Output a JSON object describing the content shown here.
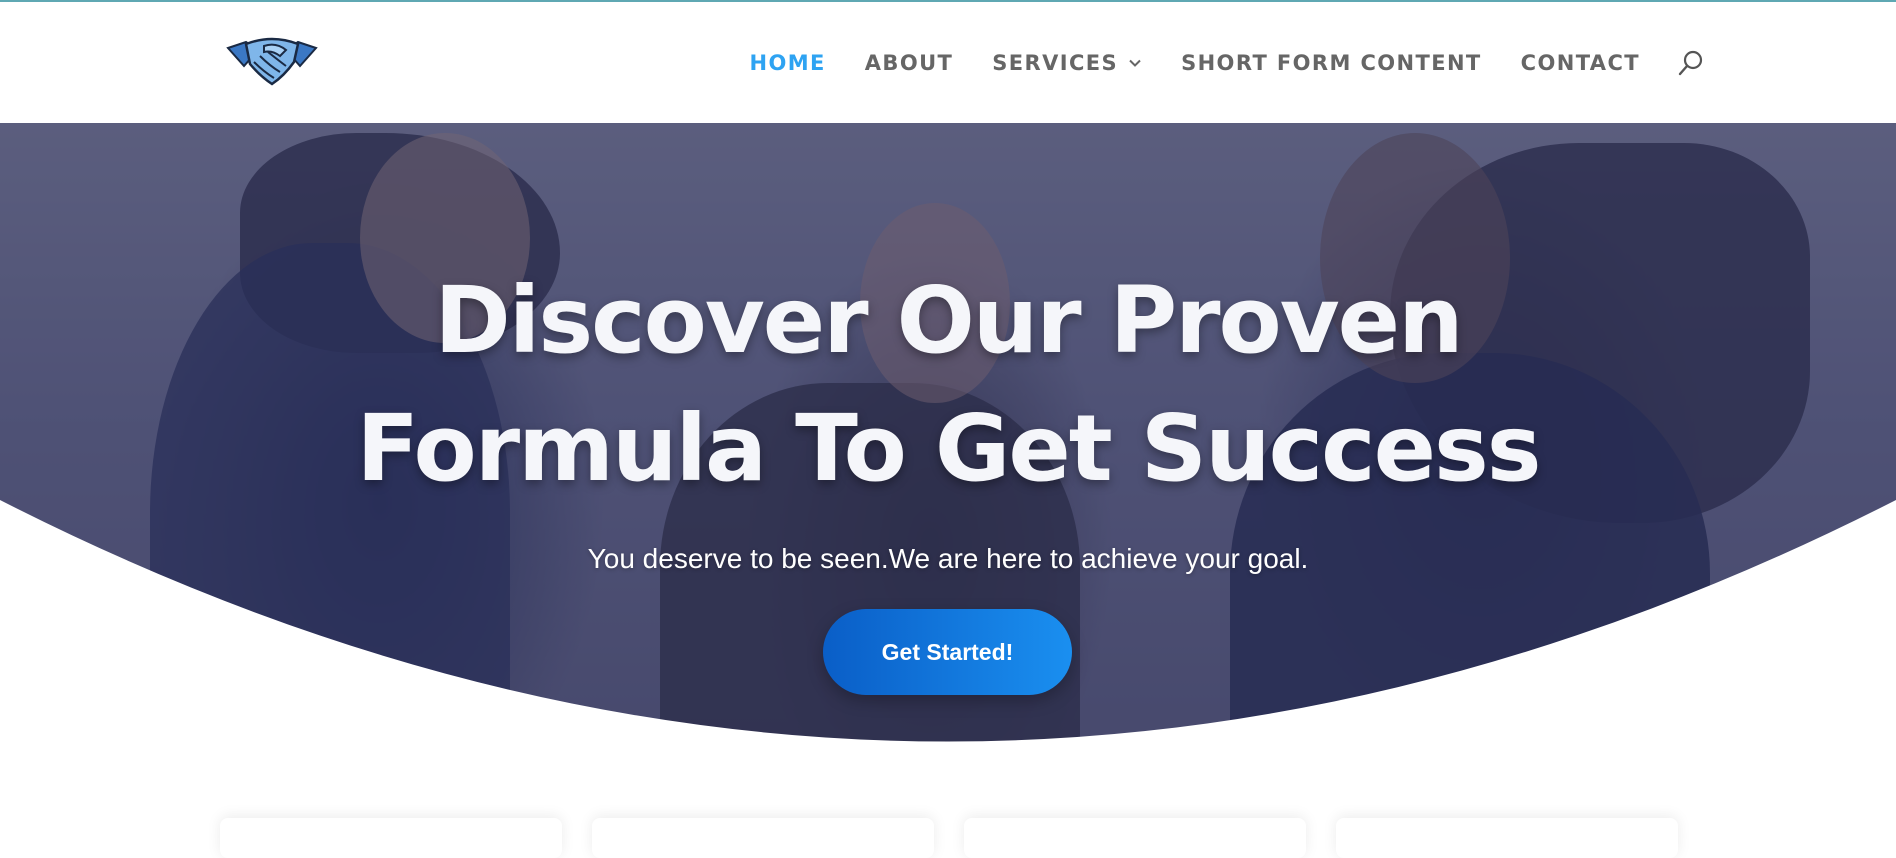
{
  "header": {
    "logo_icon": "handshake-icon",
    "nav": [
      {
        "label": "HOME",
        "active": true
      },
      {
        "label": "ABOUT",
        "active": false
      },
      {
        "label": "SERVICES",
        "active": false,
        "has_dropdown": true
      },
      {
        "label": "SHORT FORM CONTENT",
        "active": false
      },
      {
        "label": "CONTACT",
        "active": false
      }
    ],
    "search_icon": "search-icon"
  },
  "hero": {
    "headline_line1": "Discover Our Proven",
    "headline_line2": "Formula To Get Success",
    "subtitle": "You deserve to be seen.We are here to  achieve your goal.",
    "cta_label": "Get Started!"
  },
  "colors": {
    "accent": "#2ea3f2",
    "nav_text": "#666666",
    "cta_start": "#0a5ec7",
    "cta_end": "#1a8ff0"
  }
}
